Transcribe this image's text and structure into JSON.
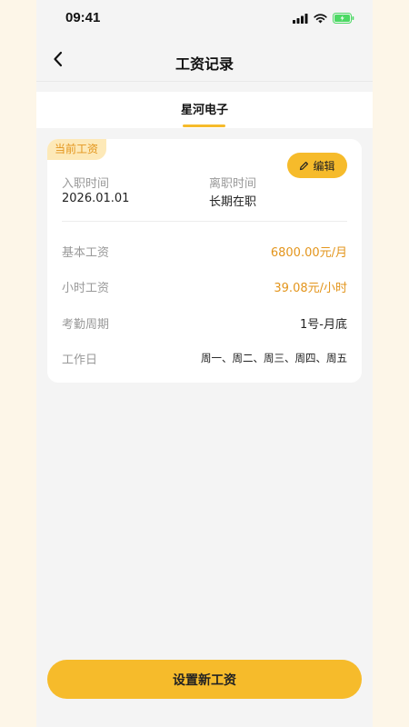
{
  "status_bar": {
    "time": "09:41"
  },
  "nav": {
    "title": "工资记录"
  },
  "company": {
    "name": "星河电子"
  },
  "card": {
    "badge": "当前工资",
    "edit_label": "编辑",
    "entry_label": "入职时间",
    "entry_value": "2026.01.01",
    "leave_label": "离职时间",
    "leave_value": "长期在职",
    "rows": [
      {
        "label": "基本工资",
        "value": "6800.00元/月"
      },
      {
        "label": "小时工资",
        "value": "39.08元/小时"
      },
      {
        "label": "考勤周期",
        "value": "1号-月底"
      },
      {
        "label": "工作日",
        "value": "周一、周二、周三、周四、周五"
      }
    ]
  },
  "bottom_button": {
    "label": "设置新工资"
  },
  "colors": {
    "accent": "#f6bb2b",
    "highlight_text": "#e3951c",
    "badge_bg": "#fde9b8",
    "page_bg": "#f4f4f4",
    "outer_bg": "#fdf6e8",
    "battery": "#4cd964"
  }
}
